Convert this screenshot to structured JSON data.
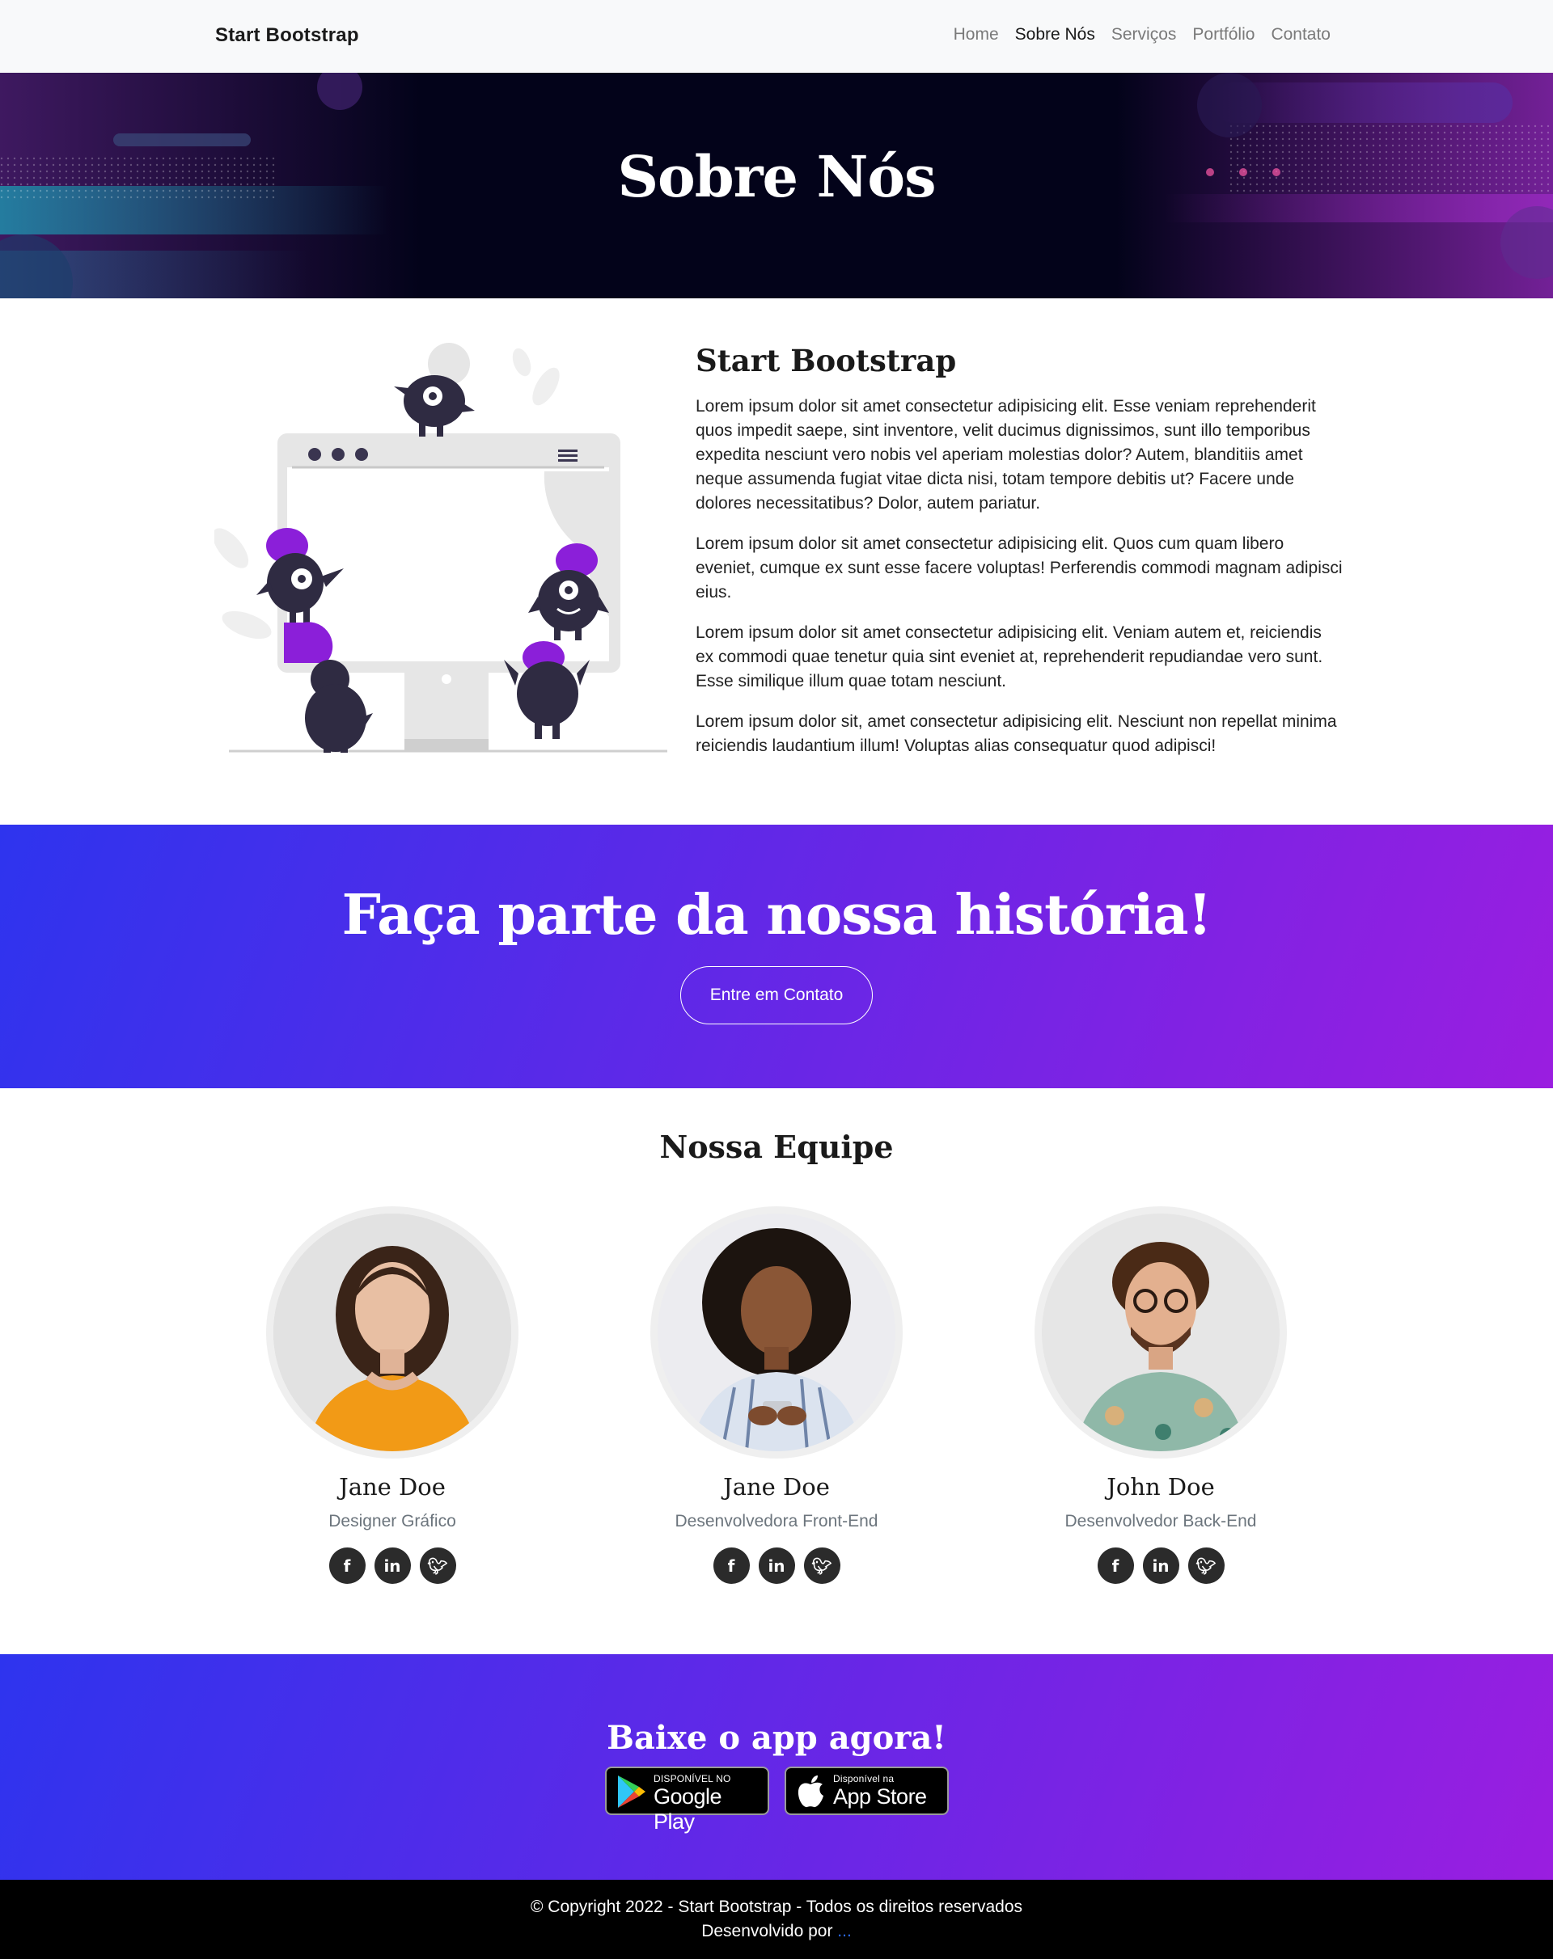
{
  "nav": {
    "brand": "Start Bootstrap",
    "links": [
      "Home",
      "Sobre Nós",
      "Serviços",
      "Portfólio",
      "Contato"
    ],
    "active": "Sobre Nós"
  },
  "hero": {
    "title": "Sobre Nós"
  },
  "about": {
    "heading": "Start Bootstrap",
    "paragraphs": [
      "Lorem ipsum dolor sit amet consectetur adipisicing elit. Esse veniam reprehenderit quos impedit saepe, sint inventore, velit ducimus dignissimos, sunt illo temporibus expedita nesciunt vero nobis vel aperiam molestias dolor? Autem, blanditiis amet neque assumenda fugiat vitae dicta nisi, totam tempore debitis ut? Facere unde dolores necessitatibus? Dolor, autem pariatur.",
      "Lorem ipsum dolor sit amet consectetur adipisicing elit. Quos cum quam libero eveniet, cumque ex sunt esse facere voluptas! Perferendis commodi magnam adipisci eius.",
      "Lorem ipsum dolor sit amet consectetur adipisicing elit. Veniam autem et, reiciendis ex commodi quae tenetur quia sint eveniet at, reprehenderit repudiandae vero sunt. Esse similique illum quae totam nesciunt.",
      "Lorem ipsum dolor sit, amet consectetur adipisicing elit. Nesciunt non repellat minima reiciendis laudantium illum! Voluptas alias consequatur quod adipisci!"
    ]
  },
  "cta": {
    "title": "Faça parte da nossa história!",
    "button": "Entre em Contato"
  },
  "team": {
    "title": "Nossa Equipe",
    "members": [
      {
        "name": "Jane Doe",
        "role": "Designer Gráfico"
      },
      {
        "name": "Jane Doe",
        "role": "Desenvolvedora Front-End"
      },
      {
        "name": "John Doe",
        "role": "Desenvolvedor Back-End"
      }
    ],
    "social_icons": [
      "facebook-icon",
      "linkedin-icon",
      "twitter-icon"
    ]
  },
  "app": {
    "title": "Baixe o app agora!",
    "google_small": "DISPONÍVEL NO",
    "google_big": "Google Play",
    "apple_small": "Disponível na",
    "apple_big": "App Store"
  },
  "footer": {
    "line1": "© Copyright 2022 - Start Bootstrap - Todos os direitos reservados",
    "line2": "Desenvolvido por",
    "link": "..."
  },
  "colors": {
    "gradient_start": "#2e34ee",
    "gradient_end": "#9a1ee0",
    "accent_purple": "#8b1fd9",
    "hero_bg": "#03031a",
    "footer_bg": "#000000"
  }
}
